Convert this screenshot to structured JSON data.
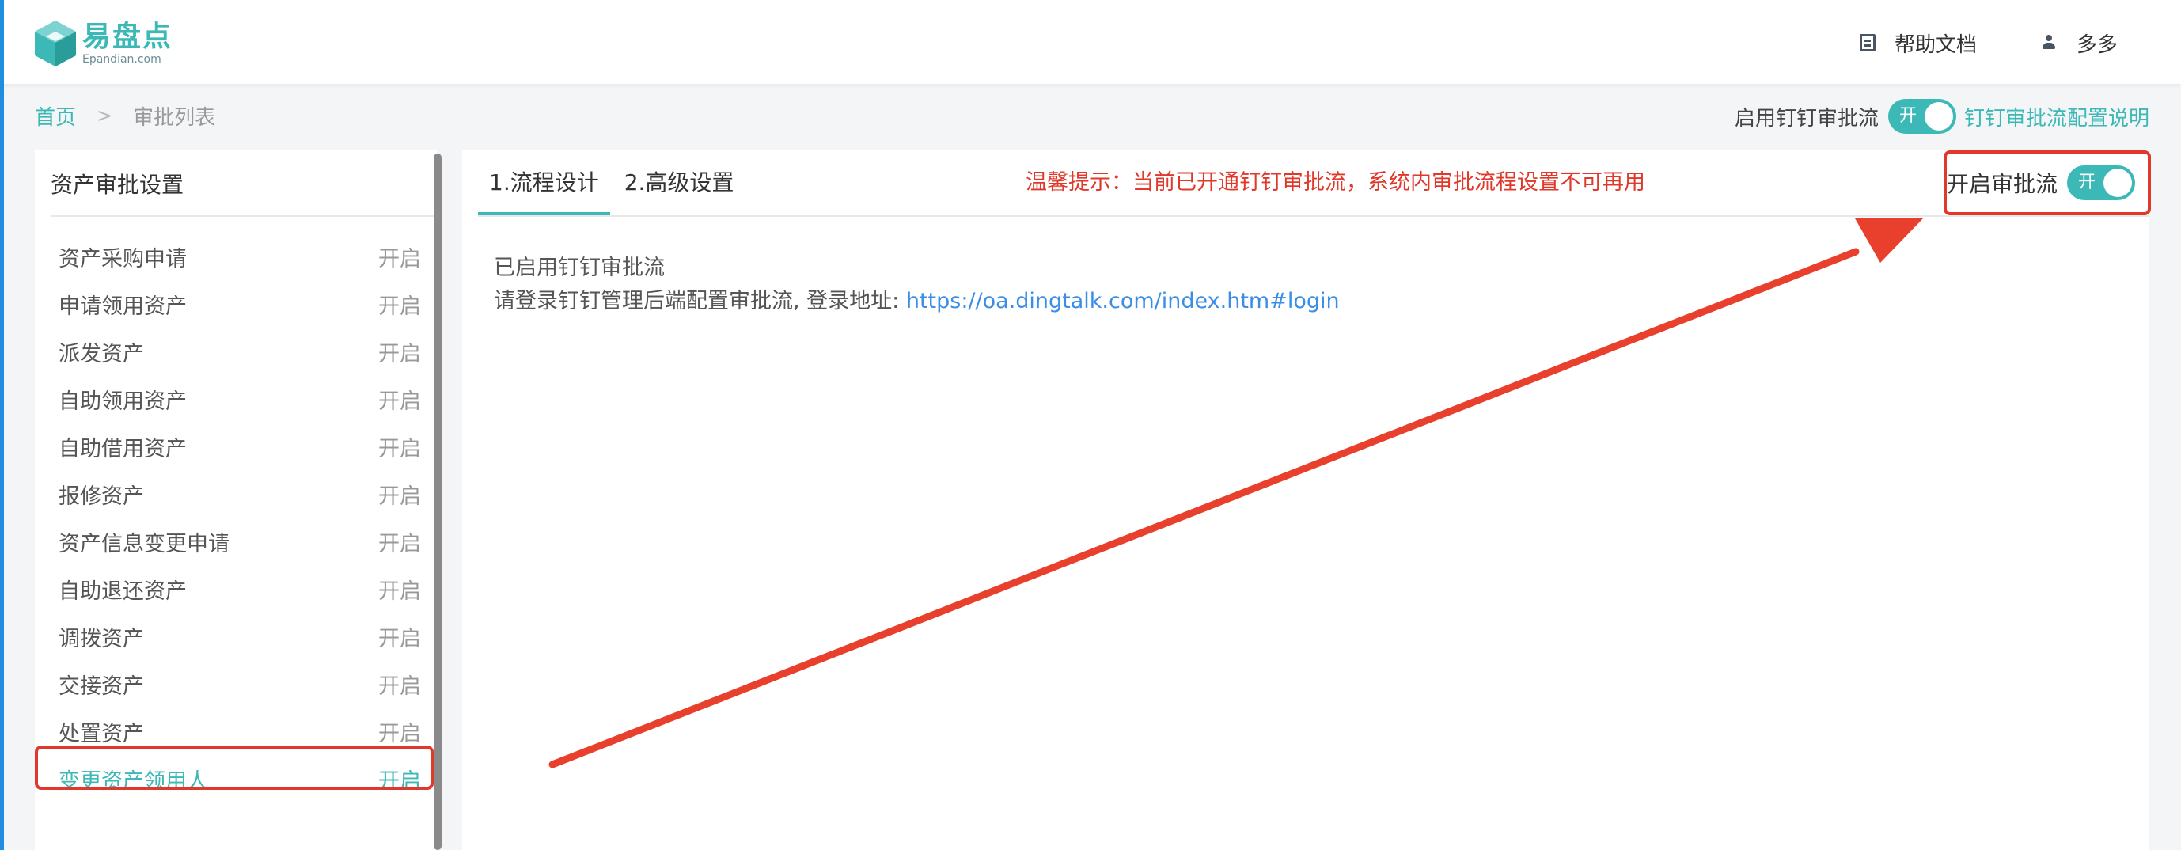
{
  "header": {
    "logo_cn": "易盘点",
    "logo_en": "Epandian.com",
    "help_label": "帮助文档",
    "user_name": "多多"
  },
  "breadcrumb": {
    "home": "首页",
    "separator": ">",
    "current": "审批列表"
  },
  "dingtalk": {
    "toggle_label": "启用钉钉审批流",
    "toggle_state": "开",
    "config_link": "钉钉审批流配置说明"
  },
  "sidebar": {
    "title": "资产审批设置",
    "items": [
      {
        "name": "资产采购申请",
        "status": "开启"
      },
      {
        "name": "申请领用资产",
        "status": "开启"
      },
      {
        "name": "派发资产",
        "status": "开启"
      },
      {
        "name": "自助领用资产",
        "status": "开启"
      },
      {
        "name": "自助借用资产",
        "status": "开启"
      },
      {
        "name": "报修资产",
        "status": "开启"
      },
      {
        "name": "资产信息变更申请",
        "status": "开启"
      },
      {
        "name": "自助退还资产",
        "status": "开启"
      },
      {
        "name": "调拨资产",
        "status": "开启"
      },
      {
        "name": "交接资产",
        "status": "开启"
      },
      {
        "name": "处置资产",
        "status": "开启"
      },
      {
        "name": "变更资产领用人",
        "status": "开启"
      }
    ]
  },
  "main": {
    "tabs": [
      {
        "label": "1.流程设计"
      },
      {
        "label": "2.高级设置"
      }
    ],
    "warning": "温馨提示：当前已开通钉钉审批流，系统内审批流程设置不可再用",
    "open_flow_label": "开启审批流",
    "open_flow_state": "开",
    "info_line1": "已启用钉钉审批流",
    "info_line2_prefix": "请登录钉钉管理后端配置审批流, 登录地址: ",
    "info_link": "https://oa.dingtalk.com/index.htm#login"
  },
  "colors": {
    "accent": "#3cb8b6",
    "warning": "#e0392b",
    "link": "#3a8ee6",
    "annotation": "#e8402c"
  }
}
